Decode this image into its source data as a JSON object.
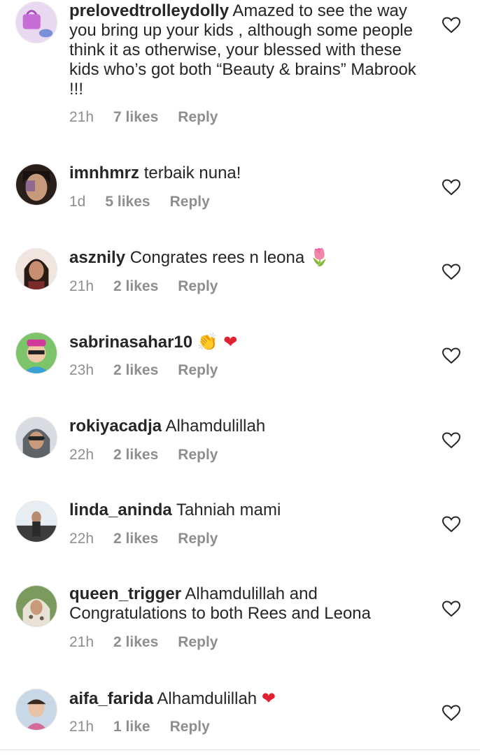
{
  "comments": [
    {
      "username": "prelovedtrolleydolly",
      "text": "Amazed to see the way you bring up your kids , although some people think it as otherwise, your blessed with these kids who’s got both “Beauty & brains”  Mabrook !!!",
      "emoji": "",
      "time": "21h",
      "likes": "7 likes",
      "reply": "Reply",
      "avatar_color": "#c56fd6"
    },
    {
      "username": "imnhmrz",
      "text": "terbaik nuna!",
      "emoji": "",
      "time": "1d",
      "likes": "5 likes",
      "reply": "Reply",
      "avatar_color": "#3a2a24"
    },
    {
      "username": "asznily",
      "text": "Congrates rees n leona",
      "emoji": "🌷",
      "time": "21h",
      "likes": "2 likes",
      "reply": "Reply",
      "avatar_color": "#5a3a32"
    },
    {
      "username": "sabrinasahar10",
      "text": "",
      "emoji": "👏 ❤",
      "time": "23h",
      "likes": "2 likes",
      "reply": "Reply",
      "avatar_color": "#4aa04a"
    },
    {
      "username": "rokiyacadja",
      "text": "Alhamdulillah",
      "emoji": "",
      "time": "22h",
      "likes": "2 likes",
      "reply": "Reply",
      "avatar_color": "#8a8f95"
    },
    {
      "username": "linda_aninda",
      "text": "Tahniah mami",
      "emoji": "",
      "time": "22h",
      "likes": "2 likes",
      "reply": "Reply",
      "avatar_color": "#6b7b8c"
    },
    {
      "username": "queen_trigger",
      "text": "Alhamdulillah and Congratulations to both Rees and Leona",
      "emoji": "",
      "time": "21h",
      "likes": "2 likes",
      "reply": "Reply",
      "avatar_color": "#6d8a5a"
    },
    {
      "username": "aifa_farida",
      "text": "Alhamdulillah",
      "emoji": "❤",
      "time": "21h",
      "likes": "1 like",
      "reply": "Reply",
      "avatar_color": "#b7c7d6"
    }
  ]
}
